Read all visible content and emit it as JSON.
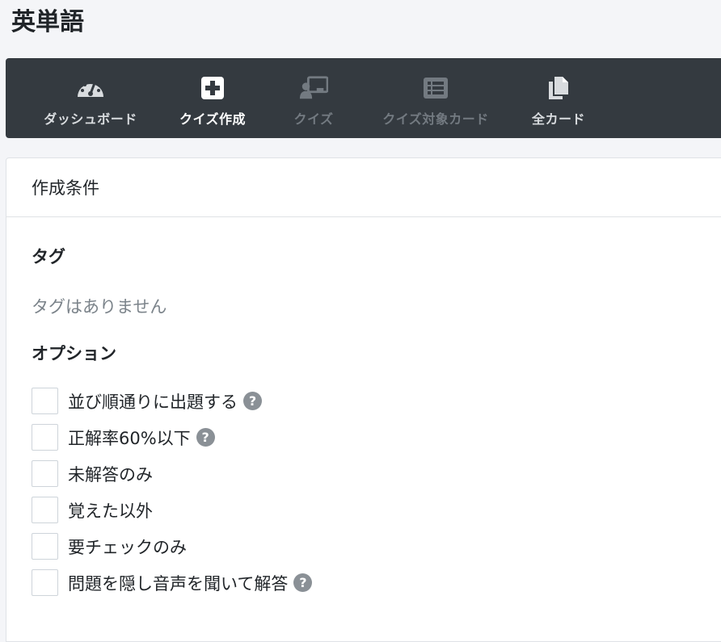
{
  "app": {
    "title": "英単語"
  },
  "nav": {
    "items": [
      {
        "label": "ダッシュボード",
        "icon": "dashboard-gauge-icon",
        "state": "light"
      },
      {
        "label": "クイズ作成",
        "icon": "plus-square-icon",
        "state": "active"
      },
      {
        "label": "クイズ",
        "icon": "chalkboard-teacher-icon",
        "state": "disabled"
      },
      {
        "label": "クイズ対象カード",
        "icon": "list-alt-icon",
        "state": "disabled"
      },
      {
        "label": "全カード",
        "icon": "copy-cards-icon",
        "state": "light"
      }
    ]
  },
  "card": {
    "header": "作成条件",
    "tags": {
      "title": "タグ",
      "empty_text": "タグはありません"
    },
    "options": {
      "title": "オプション",
      "items": [
        {
          "label": "並び順通りに出題する",
          "help": true,
          "checked": false
        },
        {
          "label": "正解率60%以下",
          "help": true,
          "checked": false
        },
        {
          "label": "未解答のみ",
          "help": false,
          "checked": false
        },
        {
          "label": "覚えた以外",
          "help": false,
          "checked": false
        },
        {
          "label": "要チェックのみ",
          "help": false,
          "checked": false
        },
        {
          "label": "問題を隠し音声を聞いて解答",
          "help": true,
          "checked": false
        }
      ]
    },
    "help_glyph": "?"
  },
  "colors": {
    "navbar_bg": "#343a40",
    "nav_active": "#ffffff",
    "nav_disabled": "#737a81",
    "help_icon_bg": "#8a9096"
  }
}
